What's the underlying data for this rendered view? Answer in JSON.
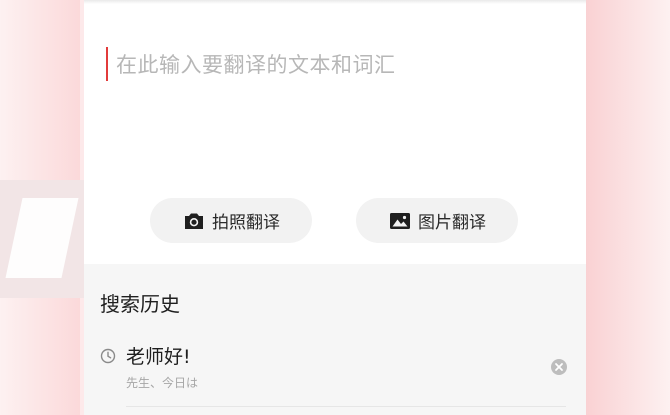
{
  "input": {
    "placeholder": "在此输入要翻译的文本和词汇"
  },
  "actions": {
    "photo_translate": {
      "label": "拍照翻译",
      "icon": "camera-icon"
    },
    "image_translate": {
      "label": "图片翻译",
      "icon": "image-icon"
    }
  },
  "history": {
    "title": "搜索历史",
    "items": [
      {
        "word": "老师好!",
        "meaning": "先生、今日は",
        "icon": "clock-icon"
      }
    ]
  },
  "colors": {
    "accent": "#e23b3b",
    "background": "#fde9ea",
    "button_bg": "#f2f2f2",
    "history_bg": "#f6f6f6"
  }
}
